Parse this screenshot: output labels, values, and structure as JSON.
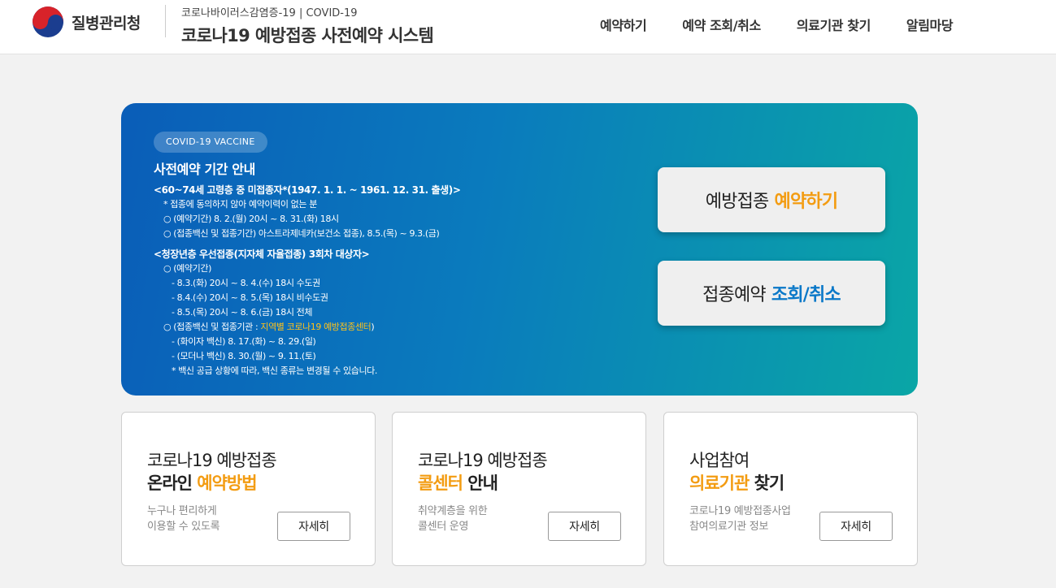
{
  "header": {
    "logo_name": "질병관리청",
    "sub_title": "코로나바이러스감염증-19 | COVID-19",
    "main_title": "코로나19 예방접종 사전예약 시스템",
    "nav": [
      "예약하기",
      "예약 조회/취소",
      "의료기관 찾기",
      "알림마당"
    ]
  },
  "banner": {
    "badge": "COVID-19 VACCINE",
    "title": "사전예약 기간 안내",
    "group1": {
      "heading": "<60~74세 고령층 중 미접종자*(1947. 1. 1. ~ 1961. 12. 31. 출생)>",
      "note": "* 접종에 동의하지 않아 예약이력이 없는 분",
      "period": "○ (예약기간) 8. 2.(월) 20시 ~ 8. 31.(화) 18시",
      "vaccine": "○ (접종백신 및 접종기간) 아스트라제네카(보건소 접종), 8.5.(목) ~ 9.3.(금)"
    },
    "group2": {
      "heading": "<청장년층 우선접종(지자체 자율접종) 3회차 대상자>",
      "period_label": "○ (예약기간)",
      "periods": [
        "- 8.3.(화) 20시 ~ 8. 4.(수) 18시 수도권",
        "- 8.4.(수) 20시 ~ 8. 5.(목) 18시 비수도권",
        "- 8.5.(목) 20시 ~ 8. 6.(금) 18시 전체"
      ],
      "vaccine_prefix": "○ (접종백신 및 접종기관 : ",
      "vaccine_highlight": "지역별 코로나19 예방접종센터",
      "vaccine_suffix": ")",
      "vaccines": [
        "- (화이자 백신) 8. 17.(화) ~ 8. 29.(일)",
        "- (모더나 백신) 8. 30.(월) ~ 9. 11.(토)"
      ],
      "footnote": "* 백신 공급 상황에 따라, 백신 종류는 변경될 수 있습니다."
    },
    "cta_reserve": {
      "prefix": "예방접종",
      "emphasis": "예약하기"
    },
    "cta_lookup": {
      "prefix": "접종예약",
      "emphasis": "조회/취소"
    }
  },
  "cards": [
    {
      "line1": "코로나19 예방접종",
      "line2_plain_before": "온라인 ",
      "line2_highlight": "예약방법",
      "line2_plain_after": "",
      "desc": [
        "누구나 편리하게",
        "이용할 수 있도록"
      ],
      "button": "자세히"
    },
    {
      "line1": "코로나19 예방접종",
      "line2_plain_before": "",
      "line2_highlight": "콜센터",
      "line2_plain_after": " 안내",
      "desc": [
        "취약계층을 위한",
        "콜센터 운영"
      ],
      "button": "자세히"
    },
    {
      "line1": "사업참여",
      "line2_plain_before": "",
      "line2_highlight": "의료기관",
      "line2_plain_after": " 찾기",
      "desc": [
        "코로나19 예방접종사업",
        "참여의료기관 정보"
      ],
      "button": "자세히"
    }
  ],
  "colors": {
    "accent_orange": "#f39c12",
    "accent_blue": "#0a78c8",
    "banner_gradient_start": "#0a5db8",
    "banner_gradient_end": "#0aa6a6",
    "highlight_yellow": "#ffc21a"
  }
}
